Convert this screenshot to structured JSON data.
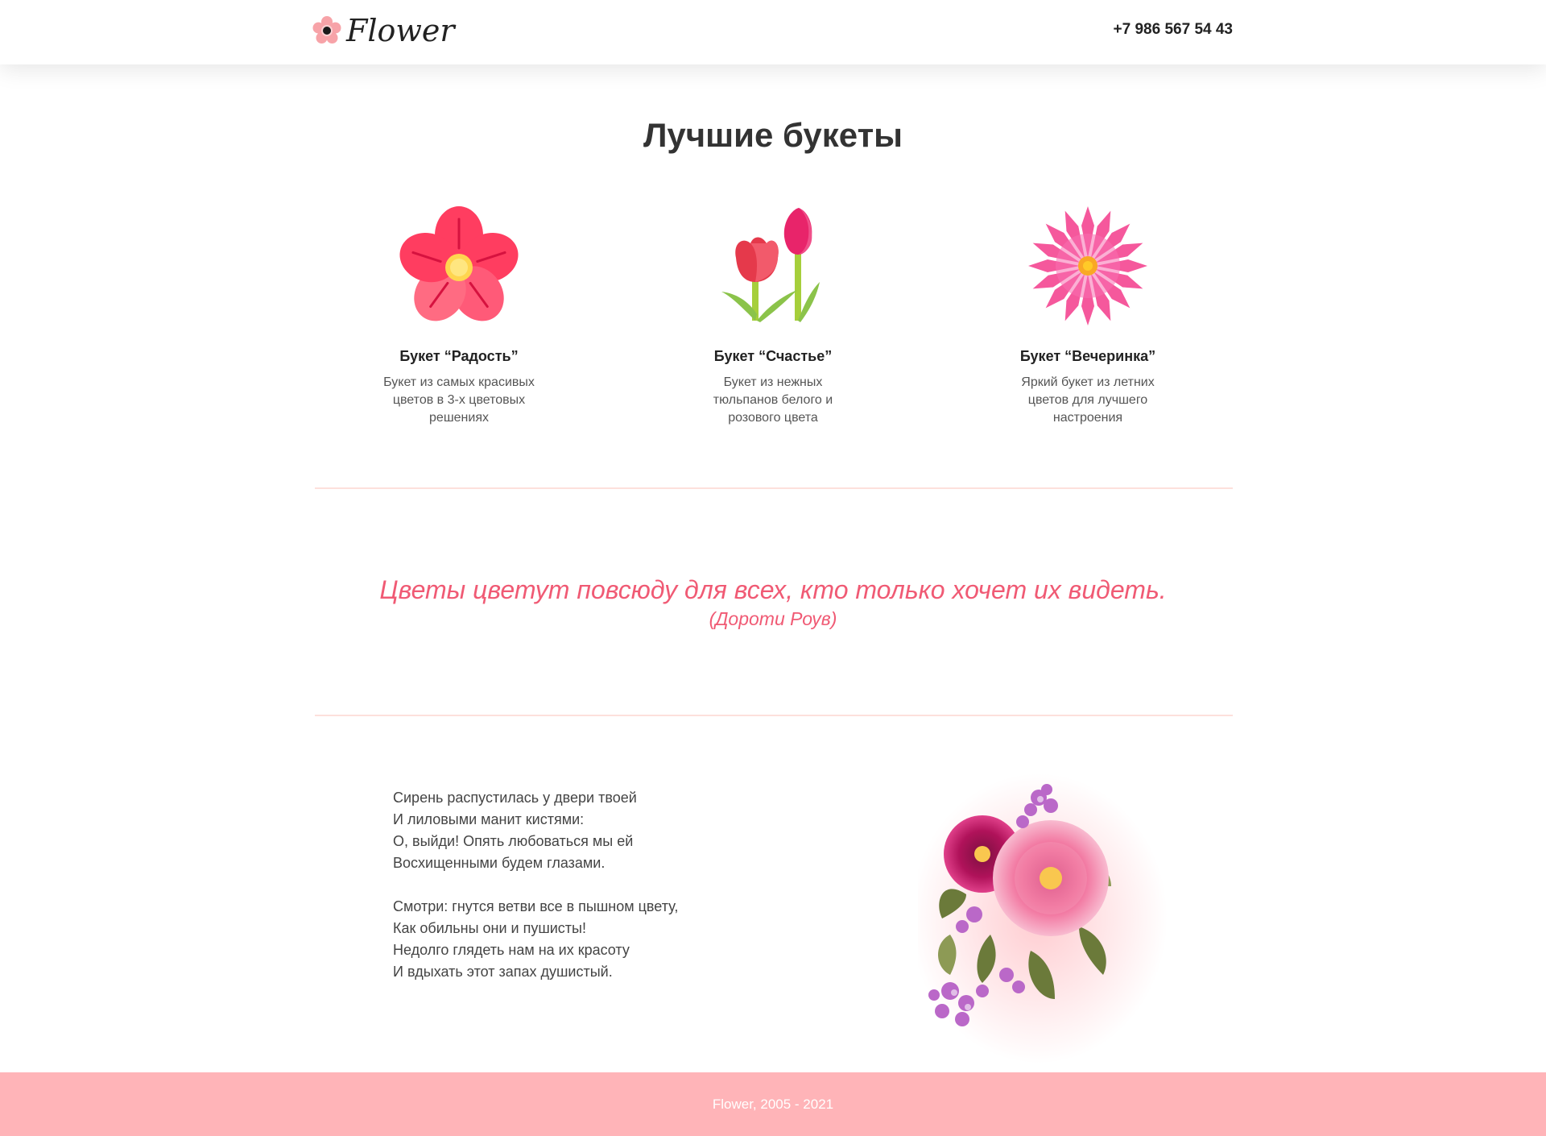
{
  "header": {
    "logo_text": "Flower",
    "logo_icon": "flower-logo-icon",
    "phone": "+7 986 567 54 43"
  },
  "bouquets": {
    "title": "Лучшие букеты",
    "items": [
      {
        "icon": "pink-flower-icon",
        "name": "Букет “Радость”",
        "description": "Букет из самых красивых цветов в 3-х цветовых решениях"
      },
      {
        "icon": "tulips-icon",
        "name": "Букет “Счастье”",
        "description": "Букет из нежных тюльпанов белого и розового цвета"
      },
      {
        "icon": "daisy-flower-icon",
        "name": "Букет “Вечеринка”",
        "description": "Яркий букет из летних цветов для лучшего настроения"
      }
    ]
  },
  "quote": {
    "text": "Цветы цветут повсюду для всех, кто только хочет их видеть.",
    "author": "(Дороти Роув)"
  },
  "poem": {
    "stanzas": [
      [
        "Сирень распустилась у двери твоей",
        "И лиловыми манит кистями:",
        "О, выйди! Опять любоваться мы ей",
        "Восхищенными будем глазами."
      ],
      [
        "Смотри: гнутся ветви все в пышном цвету,",
        "Как обильны они и пушисты!",
        "Недолго глядеть нам на их красоту",
        "И вдыхать этот запах душистый."
      ]
    ]
  },
  "footer": {
    "text": "Flower, 2005 - 2021"
  },
  "colors": {
    "accent": "#f05a74",
    "footer_bg": "#ffb4b8",
    "divider": "#fde0dc"
  }
}
